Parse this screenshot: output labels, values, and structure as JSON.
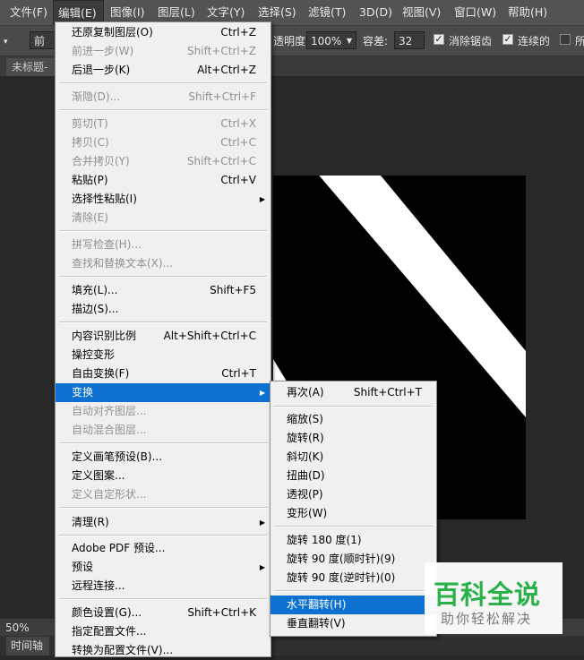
{
  "menubar": [
    {
      "label": "文件(F)"
    },
    {
      "label": "编辑(E)"
    },
    {
      "label": "图像(I)"
    },
    {
      "label": "图层(L)"
    },
    {
      "label": "文字(Y)"
    },
    {
      "label": "选择(S)"
    },
    {
      "label": "滤镜(T)"
    },
    {
      "label": "3D(D)"
    },
    {
      "label": "视图(V)"
    },
    {
      "label": "窗口(W)"
    },
    {
      "label": "帮助(H)"
    }
  ],
  "options": {
    "mode_label": "前景",
    "opacity_label": "透明度:",
    "opacity_value": "100%",
    "tolerance_label": "容差:",
    "tolerance_value": "32",
    "antialias_label": "消除锯齿",
    "contiguous_label": "连续的",
    "all_layers_label": "所"
  },
  "document": {
    "tab_label": "未标题-"
  },
  "status": {
    "zoom": "50%",
    "timeline_tab": "时间轴"
  },
  "edit_menu": [
    {
      "label": "还原复制图层(O)",
      "shortcut": "Ctrl+Z"
    },
    {
      "label": "前进一步(W)",
      "shortcut": "Shift+Ctrl+Z"
    },
    {
      "label": "后退一步(K)",
      "shortcut": "Alt+Ctrl+Z"
    },
    {
      "label": "渐隐(D)...",
      "shortcut": "Shift+Ctrl+F"
    },
    {
      "label": "剪切(T)",
      "shortcut": "Ctrl+X"
    },
    {
      "label": "拷贝(C)",
      "shortcut": "Ctrl+C"
    },
    {
      "label": "合并拷贝(Y)",
      "shortcut": "Shift+Ctrl+C"
    },
    {
      "label": "粘贴(P)",
      "shortcut": "Ctrl+V"
    },
    {
      "label": "选择性粘贴(I)",
      "shortcut": ""
    },
    {
      "label": "清除(E)",
      "shortcut": ""
    },
    {
      "label": "拼写检查(H)...",
      "shortcut": ""
    },
    {
      "label": "查找和替换文本(X)...",
      "shortcut": ""
    },
    {
      "label": "填充(L)...",
      "shortcut": "Shift+F5"
    },
    {
      "label": "描边(S)...",
      "shortcut": ""
    },
    {
      "label": "内容识别比例",
      "shortcut": "Alt+Shift+Ctrl+C"
    },
    {
      "label": "操控变形",
      "shortcut": ""
    },
    {
      "label": "自由变换(F)",
      "shortcut": "Ctrl+T"
    },
    {
      "label": "变换",
      "shortcut": ""
    },
    {
      "label": "自动对齐图层...",
      "shortcut": ""
    },
    {
      "label": "自动混合图层...",
      "shortcut": ""
    },
    {
      "label": "定义画笔预设(B)...",
      "shortcut": ""
    },
    {
      "label": "定义图案...",
      "shortcut": ""
    },
    {
      "label": "定义自定形状...",
      "shortcut": ""
    },
    {
      "label": "清理(R)",
      "shortcut": ""
    },
    {
      "label": "Adobe PDF 预设...",
      "shortcut": ""
    },
    {
      "label": "预设",
      "shortcut": ""
    },
    {
      "label": "远程连接...",
      "shortcut": ""
    },
    {
      "label": "颜色设置(G)...",
      "shortcut": "Shift+Ctrl+K"
    },
    {
      "label": "指定配置文件...",
      "shortcut": ""
    },
    {
      "label": "转换为配置文件(V)...",
      "shortcut": ""
    }
  ],
  "transform_menu": [
    {
      "label": "再次(A)",
      "shortcut": "Shift+Ctrl+T"
    },
    {
      "label": "缩放(S)",
      "shortcut": ""
    },
    {
      "label": "旋转(R)",
      "shortcut": ""
    },
    {
      "label": "斜切(K)",
      "shortcut": ""
    },
    {
      "label": "扭曲(D)",
      "shortcut": ""
    },
    {
      "label": "透视(P)",
      "shortcut": ""
    },
    {
      "label": "变形(W)",
      "shortcut": ""
    },
    {
      "label": "旋转 180 度(1)",
      "shortcut": ""
    },
    {
      "label": "旋转 90 度(顺时针)(9)",
      "shortcut": ""
    },
    {
      "label": "旋转 90 度(逆时针)(0)",
      "shortcut": ""
    },
    {
      "label": "水平翻转(H)",
      "shortcut": ""
    },
    {
      "label": "垂直翻转(V)",
      "shortcut": ""
    }
  ],
  "watermark": {
    "title": "百科全说",
    "subtitle": "助你轻松解决"
  },
  "colors": {
    "highlight": "#0d71d2",
    "watermark_green": "#2bb14a"
  }
}
